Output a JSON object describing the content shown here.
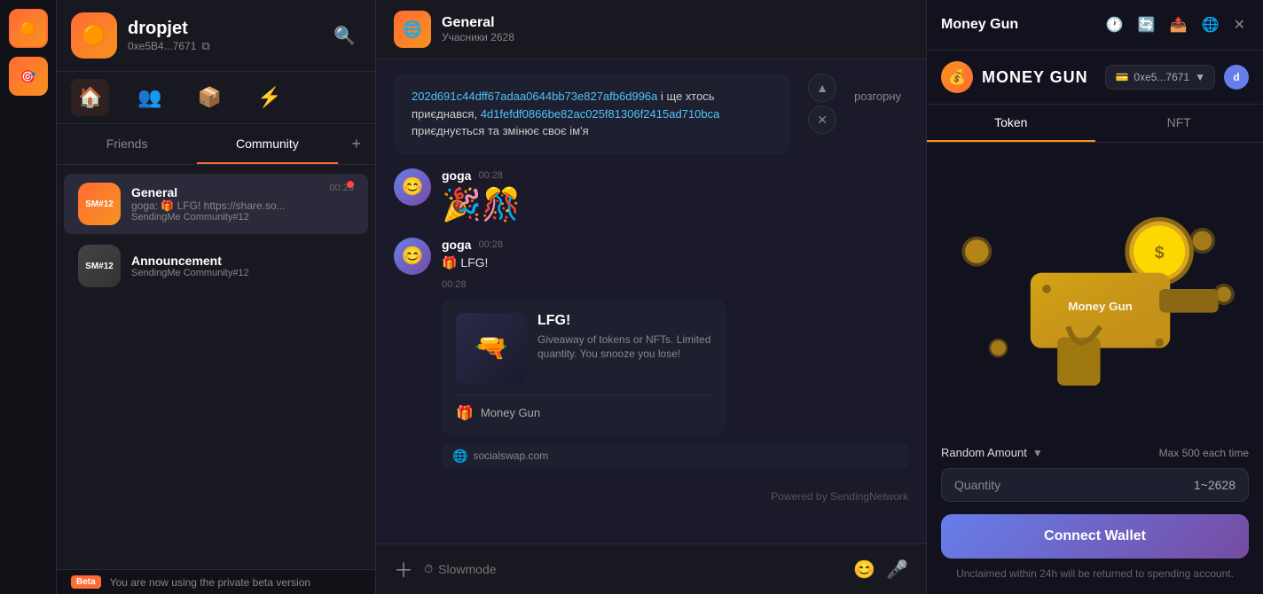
{
  "app": {
    "name": "dropjet",
    "address": "0xe5B4...7671",
    "logo_emoji": "🟠"
  },
  "nav": {
    "icons": [
      "🏠",
      "👥",
      "📦",
      "⚡"
    ],
    "active_index": 0
  },
  "tabs": {
    "items": [
      "Friends",
      "Community"
    ],
    "active": "Community",
    "add_label": "+"
  },
  "channels": [
    {
      "name": "General",
      "subtitle": "SendingMe Community#12",
      "preview": "goga: 🎁 LFG! https://share.so...",
      "time": "00:28",
      "unread": true,
      "active": true
    },
    {
      "name": "Announcement",
      "subtitle": "SendingMe Community#12",
      "preview": "",
      "time": "",
      "unread": false,
      "active": false
    }
  ],
  "chat": {
    "channel_name": "General",
    "channel_members": "Учасники 2628",
    "messages": [
      {
        "type": "system",
        "text": "202d691c44dff67adaa0644bb73e827afb6d996a і ще хтось приєднався, 4d1fefdf0866be82ac025f81306f2415ad710bca приєднується та змінює своє ім'я",
        "expand_label": "розгорну",
        "time": ""
      },
      {
        "type": "chat",
        "user": "goga",
        "time": "00:28",
        "text": "🎉🎊",
        "emoji_size": true
      },
      {
        "type": "chat",
        "user": "goga",
        "time": "00:28",
        "text": "🎁 LFG!",
        "has_card": true
      }
    ],
    "card": {
      "title": "LFG!",
      "description": "Giveaway of tokens or NFTs. Limited quantity. You snooze you lose!",
      "footer_icon": "🎁",
      "footer_text": "Money Gun"
    },
    "domain1": "socialswap.com",
    "domain2": "socialswap.com",
    "powered_by": "Powered by SendingNetwork",
    "input_placeholder": "Slowmode",
    "card_time": "00:28"
  },
  "right_panel": {
    "title": "Money Gun",
    "wallet_address": "0xe5...7671",
    "tabs": [
      "Token",
      "NFT"
    ],
    "active_tab": "Token",
    "nft_name": "MONEY GUN",
    "random_amount_label": "Random Amount",
    "max_label": "Max 500 each time",
    "quantity_label": "Quantity",
    "quantity_value": "1~2628",
    "connect_wallet_label": "Connect Wallet",
    "unclaimed_text": "Unclaimed within 24h will be returned to spending account.",
    "actions": [
      "🕐",
      "🔄",
      "📤",
      "🌐",
      "✕"
    ]
  },
  "beta": {
    "badge": "Beta",
    "text": "You are now using the private beta version"
  }
}
